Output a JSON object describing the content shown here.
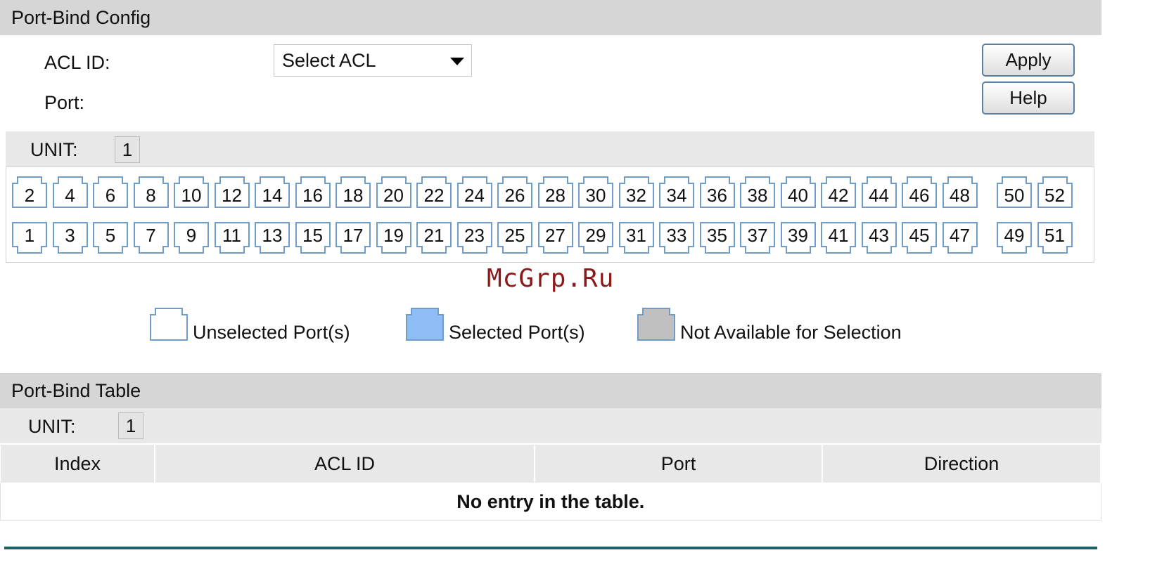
{
  "config": {
    "header": "Port-Bind Config",
    "acl_label": "ACL ID:",
    "acl_select_value": "Select ACL",
    "port_label": "Port:",
    "apply_label": "Apply",
    "help_label": "Help",
    "unit_label": "UNIT:",
    "unit_value": "1"
  },
  "ports": {
    "top_row": [
      "2",
      "4",
      "6",
      "8",
      "10",
      "12",
      "14",
      "16",
      "18",
      "20",
      "22",
      "24",
      "26",
      "28",
      "30",
      "32",
      "34",
      "36",
      "38",
      "40",
      "42",
      "44",
      "46",
      "48",
      "50",
      "52"
    ],
    "bottom_row": [
      "1",
      "3",
      "5",
      "7",
      "9",
      "11",
      "13",
      "15",
      "17",
      "19",
      "21",
      "23",
      "25",
      "27",
      "29",
      "31",
      "33",
      "35",
      "37",
      "39",
      "41",
      "43",
      "45",
      "47",
      "49",
      "51"
    ]
  },
  "watermark": "McGrp.Ru",
  "legend": {
    "unselected": "Unselected Port(s)",
    "selected": "Selected Port(s)",
    "unavailable": "Not Available for Selection"
  },
  "colors": {
    "port_border": "#6f9cc9",
    "selected_fill": "#8fbdf5",
    "unavailable_fill": "#c0c0c0",
    "bottom_line": "#1f5f67"
  },
  "table": {
    "header": "Port-Bind Table",
    "unit_label": "UNIT:",
    "unit_value": "1",
    "columns": [
      "Index",
      "ACL ID",
      "Port",
      "Direction"
    ],
    "empty_message": "No entry in the table."
  }
}
